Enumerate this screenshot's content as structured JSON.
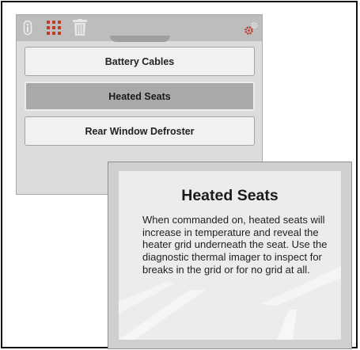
{
  "toolbar": {
    "icons": [
      "info-icon",
      "grid-icon",
      "trash-icon",
      "settings-gears-icon"
    ],
    "colors": {
      "bar": "#bdbdbd",
      "accent": "#c0392b",
      "icon": "#e0e0e0"
    }
  },
  "list": {
    "items": [
      {
        "label": "Battery Cables",
        "selected": false
      },
      {
        "label": "Heated Seats",
        "selected": true
      },
      {
        "label": "Rear Window Defroster",
        "selected": false
      }
    ]
  },
  "info": {
    "title": "Heated Seats",
    "body": "When commanded on, heated seats will increase in temperature and reveal the heater grid underneath the seat. Use the diagnostic thermal imager to inspect for breaks in the grid or for no grid at all."
  }
}
